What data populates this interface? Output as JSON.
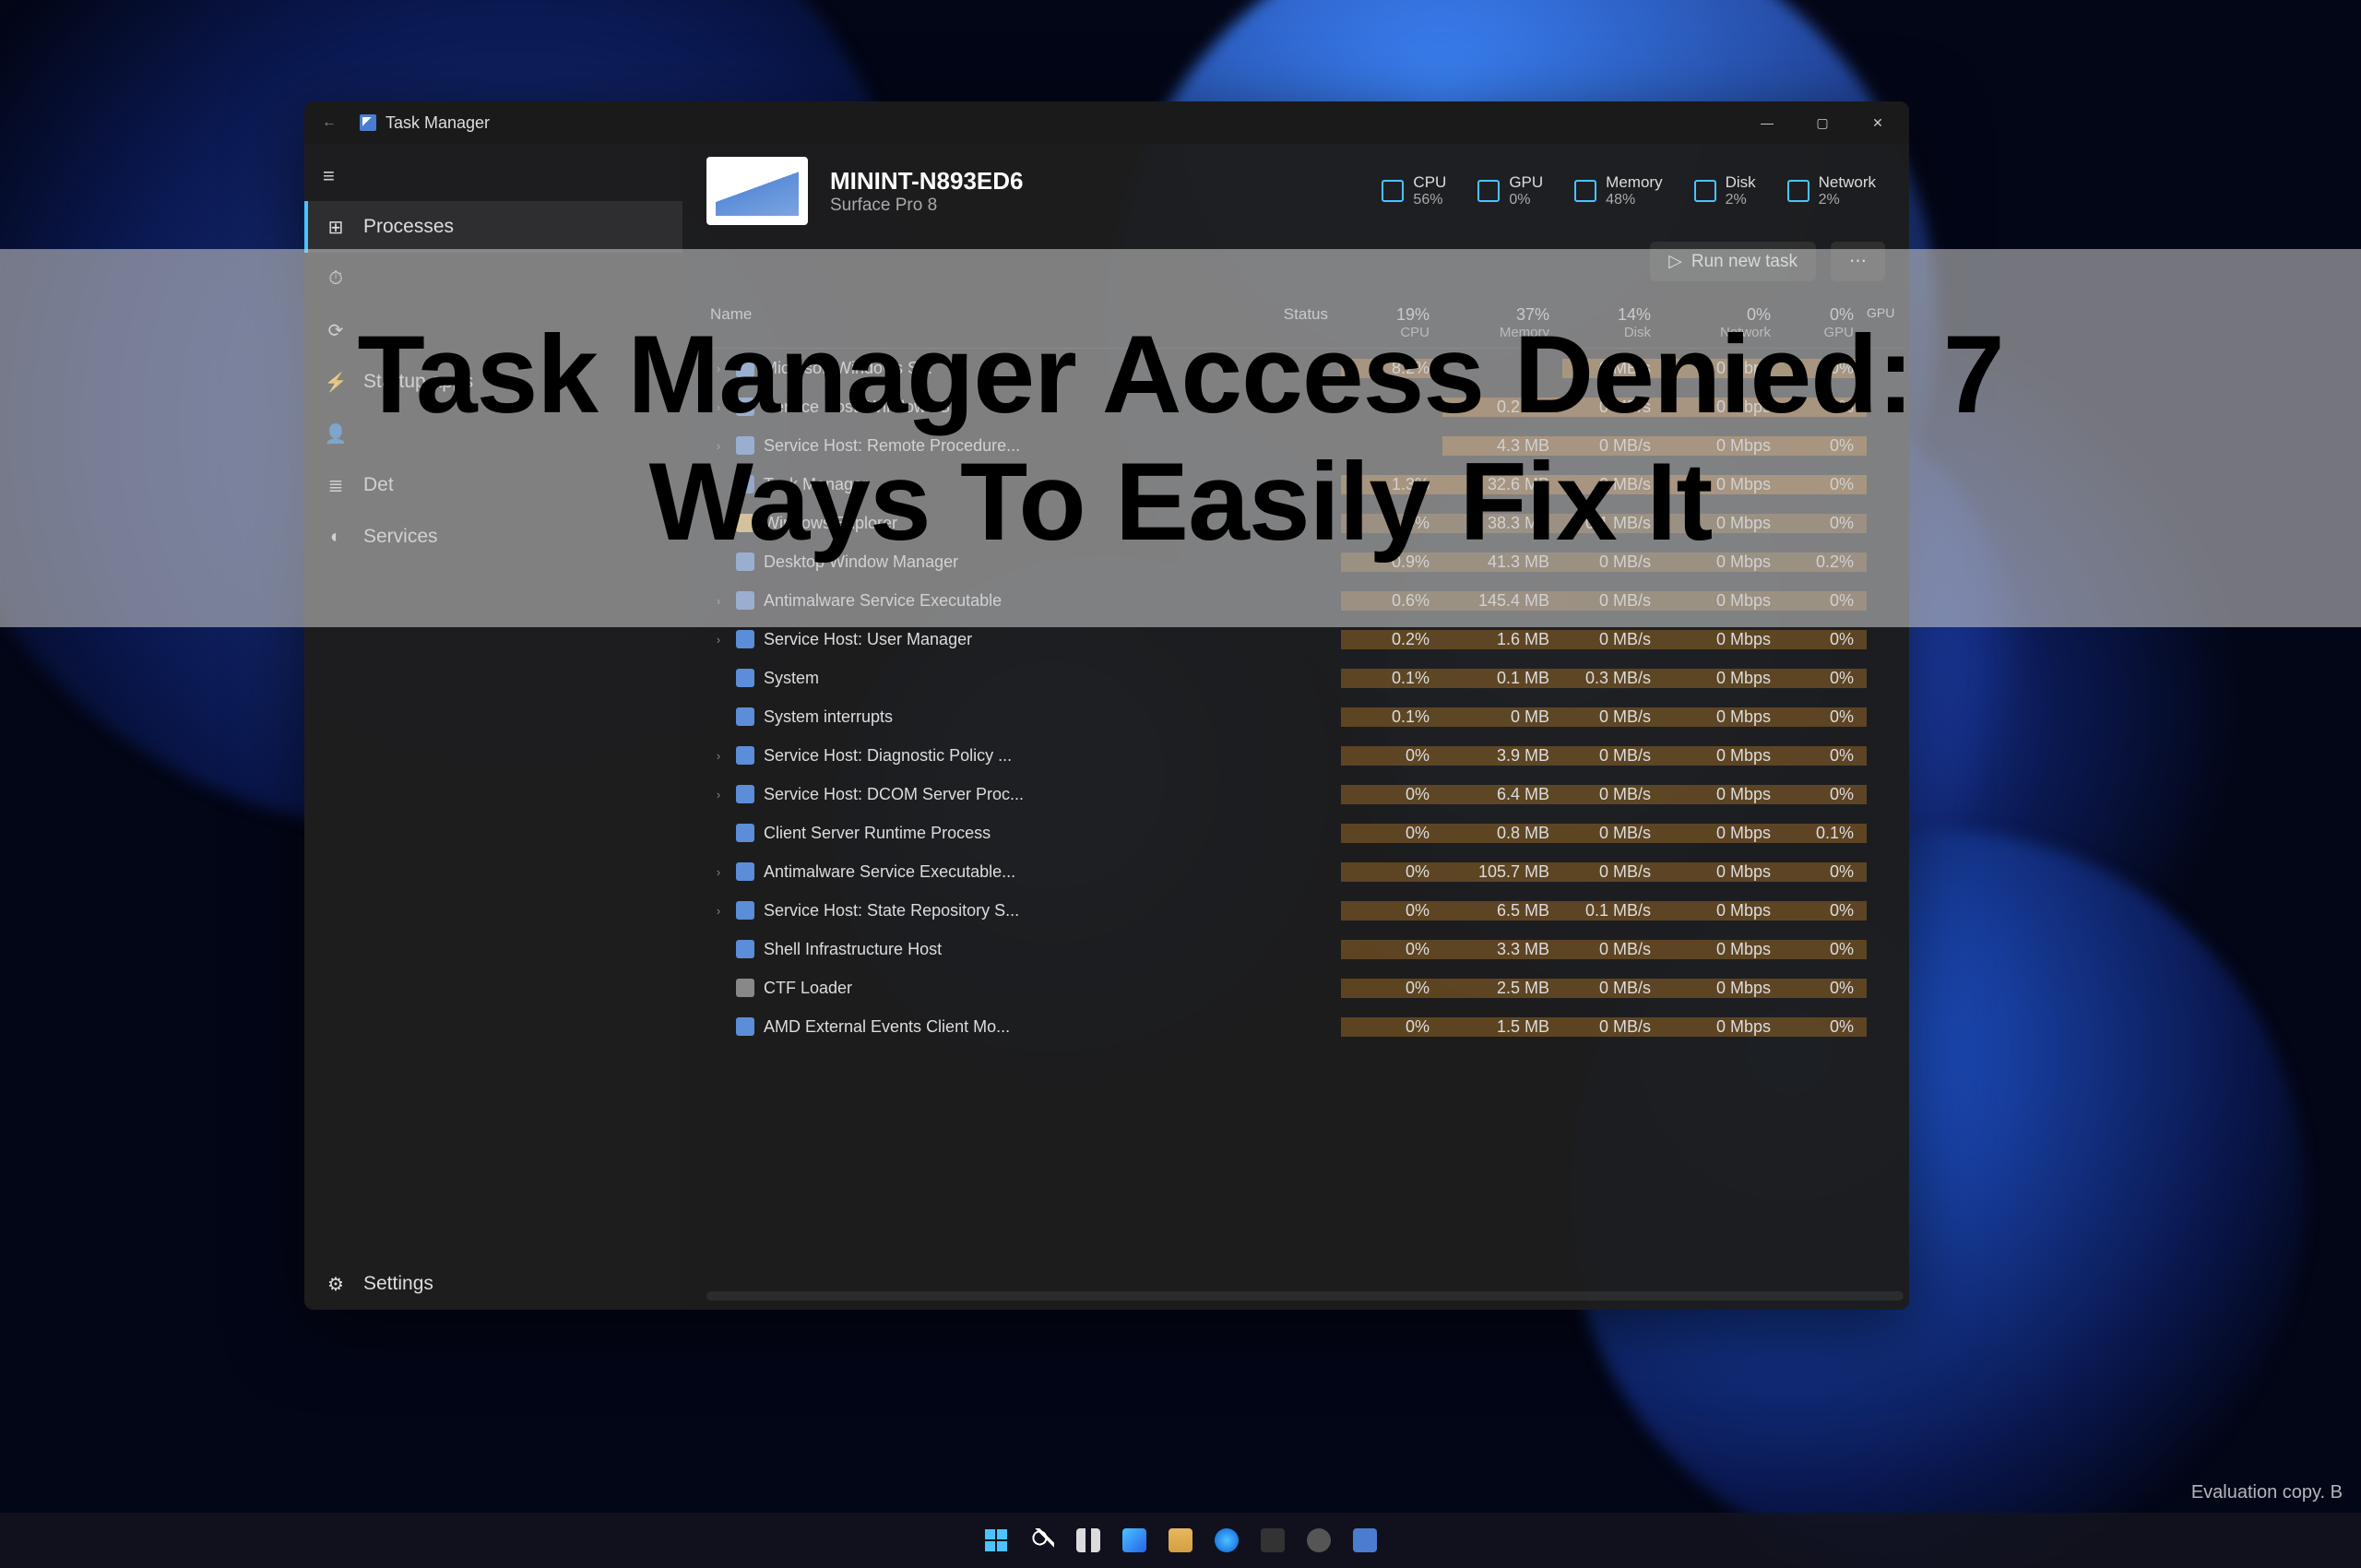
{
  "overlay": {
    "title_line1": "Task Manager Access Denied: 7",
    "title_line2": "Ways To Easily Fix It"
  },
  "desktop": {
    "eval_text": "Evaluation copy. B"
  },
  "window": {
    "title": "Task Manager",
    "back_glyph": "←",
    "controls": {
      "min": "—",
      "max": "▢",
      "close": "✕"
    }
  },
  "sidebar": {
    "hamburger": "≡",
    "items": [
      {
        "icon": "⊞",
        "label": "Processes",
        "active": true
      },
      {
        "icon": "⏱",
        "label": ""
      },
      {
        "icon": "⟳",
        "label": ""
      },
      {
        "icon": "⚡",
        "label": "Startup apps"
      },
      {
        "icon": "👤",
        "label": ""
      },
      {
        "icon": "≣",
        "label": "Det"
      },
      {
        "icon": "◐",
        "label": "Services"
      }
    ],
    "settings": {
      "icon": "⚙",
      "label": "Settings"
    }
  },
  "device": {
    "name": "MININT-N893ED6",
    "model": "Surface Pro 8"
  },
  "meters": [
    {
      "label": "CPU",
      "value": "56%",
      "color": "#4cc2ff"
    },
    {
      "label": "GPU",
      "value": "0%",
      "color": "#4cc2ff"
    },
    {
      "label": "Memory",
      "value": "48%",
      "color": "#4cc2ff"
    },
    {
      "label": "Disk",
      "value": "2%",
      "color": "#4cc2ff"
    },
    {
      "label": "Network",
      "value": "2%",
      "color": "#4cc2ff"
    }
  ],
  "actions": [
    {
      "label": "Run new task",
      "icon": "▷"
    },
    {
      "label": "",
      "icon": "⋯"
    }
  ],
  "columns": {
    "name": "Name",
    "status": "Status",
    "cpu": {
      "pct": "19%",
      "lbl": "CPU"
    },
    "memory": {
      "pct": "37%",
      "lbl": "Memory"
    },
    "disk": {
      "pct": "14%",
      "lbl": "Disk"
    },
    "network": {
      "pct": "0%",
      "lbl": "Network"
    },
    "gpu": {
      "pct": "0%",
      "lbl": "GPU"
    },
    "gpu2": "GPU"
  },
  "processes": [
    {
      "exp": "›",
      "name": "Microsoft Windows S...",
      "ico": "#5b8dd8",
      "cpu": "8.2%",
      "mem": "",
      "disk": "0 MB/s",
      "net": "0 Mbps",
      "gpu": "0%"
    },
    {
      "exp": "›",
      "name": "Service Host: Windows S...",
      "ico": "#5b8dd8",
      "cpu": "",
      "mem": "0.2 MB",
      "disk": "0 MB/s",
      "net": "0 Mbps",
      "gpu": "0%"
    },
    {
      "exp": "›",
      "name": "Service Host: Remote Procedure...",
      "ico": "#5b8dd8",
      "cpu": "",
      "mem": "4.3 MB",
      "disk": "0 MB/s",
      "net": "0 Mbps",
      "gpu": "0%"
    },
    {
      "exp": "",
      "name": "Task Manager",
      "ico": "#4a7dd0",
      "cpu": "1.3%",
      "mem": "32.6 MB",
      "disk": "0 MB/s",
      "net": "0 Mbps",
      "gpu": "0%"
    },
    {
      "exp": "",
      "name": "Windows Explorer",
      "ico": "#e6b860",
      "cpu": "1.0%",
      "mem": "38.3 MB",
      "disk": "0.1 MB/s",
      "net": "0 Mbps",
      "gpu": "0%"
    },
    {
      "exp": "",
      "name": "Desktop Window Manager",
      "ico": "#5b8dd8",
      "cpu": "0.9%",
      "mem": "41.3 MB",
      "disk": "0 MB/s",
      "net": "0 Mbps",
      "gpu": "0.2%"
    },
    {
      "exp": "›",
      "name": "Antimalware Service Executable",
      "ico": "#5b8dd8",
      "cpu": "0.6%",
      "mem": "145.4 MB",
      "disk": "0 MB/s",
      "net": "0 Mbps",
      "gpu": "0%"
    },
    {
      "exp": "›",
      "name": "Service Host: User Manager",
      "ico": "#5b8dd8",
      "cpu": "0.2%",
      "mem": "1.6 MB",
      "disk": "0 MB/s",
      "net": "0 Mbps",
      "gpu": "0%"
    },
    {
      "exp": "",
      "name": "System",
      "ico": "#5b8dd8",
      "cpu": "0.1%",
      "mem": "0.1 MB",
      "disk": "0.3 MB/s",
      "net": "0 Mbps",
      "gpu": "0%"
    },
    {
      "exp": "",
      "name": "System interrupts",
      "ico": "#5b8dd8",
      "cpu": "0.1%",
      "mem": "0 MB",
      "disk": "0 MB/s",
      "net": "0 Mbps",
      "gpu": "0%"
    },
    {
      "exp": "›",
      "name": "Service Host: Diagnostic Policy ...",
      "ico": "#5b8dd8",
      "cpu": "0%",
      "mem": "3.9 MB",
      "disk": "0 MB/s",
      "net": "0 Mbps",
      "gpu": "0%"
    },
    {
      "exp": "›",
      "name": "Service Host: DCOM Server Proc...",
      "ico": "#5b8dd8",
      "cpu": "0%",
      "mem": "6.4 MB",
      "disk": "0 MB/s",
      "net": "0 Mbps",
      "gpu": "0%"
    },
    {
      "exp": "",
      "name": "Client Server Runtime Process",
      "ico": "#5b8dd8",
      "cpu": "0%",
      "mem": "0.8 MB",
      "disk": "0 MB/s",
      "net": "0 Mbps",
      "gpu": "0.1%"
    },
    {
      "exp": "›",
      "name": "Antimalware Service Executable...",
      "ico": "#5b8dd8",
      "cpu": "0%",
      "mem": "105.7 MB",
      "disk": "0 MB/s",
      "net": "0 Mbps",
      "gpu": "0%"
    },
    {
      "exp": "›",
      "name": "Service Host: State Repository S...",
      "ico": "#5b8dd8",
      "cpu": "0%",
      "mem": "6.5 MB",
      "disk": "0.1 MB/s",
      "net": "0 Mbps",
      "gpu": "0%"
    },
    {
      "exp": "",
      "name": "Shell Infrastructure Host",
      "ico": "#5b8dd8",
      "cpu": "0%",
      "mem": "3.3 MB",
      "disk": "0 MB/s",
      "net": "0 Mbps",
      "gpu": "0%"
    },
    {
      "exp": "",
      "name": "CTF Loader",
      "ico": "#888",
      "cpu": "0%",
      "mem": "2.5 MB",
      "disk": "0 MB/s",
      "net": "0 Mbps",
      "gpu": "0%"
    },
    {
      "exp": "",
      "name": "AMD External Events Client Mo...",
      "ico": "#5b8dd8",
      "cpu": "0%",
      "mem": "1.5 MB",
      "disk": "0 MB/s",
      "net": "0 Mbps",
      "gpu": "0%"
    }
  ],
  "taskbar": {
    "icons": [
      "start",
      "search",
      "taskview",
      "widgets",
      "explorer",
      "edge",
      "store",
      "settings",
      "taskmanager"
    ]
  }
}
